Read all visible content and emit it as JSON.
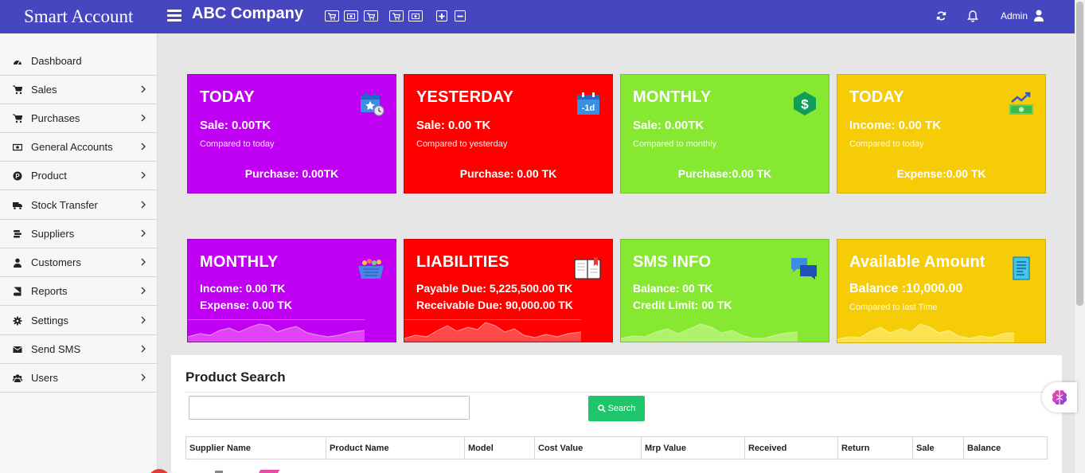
{
  "header": {
    "brand": "Smart Account",
    "company": "ABC Company",
    "quick_icons": [
      "cart-icon",
      "cash-icon",
      "cart-icon",
      "cart-icon",
      "cash-icon",
      "plus-icon",
      "minus-icon"
    ],
    "user": "Admin",
    "color": "#4646c1"
  },
  "sidebar": {
    "items": [
      {
        "label": "Dashboard",
        "icon": "dashboard-icon"
      },
      {
        "label": "Sales",
        "icon": "cart-icon"
      },
      {
        "label": "Purchases",
        "icon": "cart-icon"
      },
      {
        "label": "General Accounts",
        "icon": "cash-icon"
      },
      {
        "label": "Product",
        "icon": "product-icon"
      },
      {
        "label": "Stock Transfer",
        "icon": "truck-icon"
      },
      {
        "label": "Suppliers",
        "icon": "stack-icon"
      },
      {
        "label": "Customers",
        "icon": "user-icon"
      },
      {
        "label": "Reports",
        "icon": "book-icon"
      },
      {
        "label": "Settings",
        "icon": "gear-icon"
      },
      {
        "label": "Send SMS",
        "icon": "envelope-icon"
      },
      {
        "label": "Users",
        "icon": "users-icon"
      }
    ]
  },
  "cards": {
    "today_sale": {
      "title": "TODAY",
      "sale": "Sale: 0.00TK",
      "note": "Compared to today",
      "footer": "Purchase: 0.00TK"
    },
    "yesterday": {
      "title": "YESTERDAY",
      "sale": "Sale: 0.00 TK",
      "note": "Compared to yesterday",
      "footer": "Purchase: 0.00 TK"
    },
    "monthly_sale": {
      "title": "MONTHLY",
      "sale": "Sale: 0.00TK",
      "note": "Compared to monthly",
      "footer": "Purchase:0.00 TK"
    },
    "today_income": {
      "title": "TODAY",
      "sale": "Income: 0.00 TK",
      "note": "Compared to today",
      "footer": "Expense:0.00 TK"
    },
    "monthly_income": {
      "title": "MONTHLY",
      "line1": "Income: 0.00 TK",
      "line2": "Expense: 0.00 TK"
    },
    "liabilities": {
      "title": "LIABILITIES",
      "line1": "Payable Due: 5,225,500.00 TK",
      "line2": "Receivable Due: 90,000.00 TK"
    },
    "sms": {
      "title": "SMS INFO",
      "line1": "Balance: 00 TK",
      "line2": "Credit Limit: 00 TK"
    },
    "available": {
      "title": "Available Amount",
      "line1": "Balance :10,000.00",
      "note": "Compared to last Time"
    }
  },
  "colors": {
    "purple": "#bf00f2",
    "red": "#ff0000",
    "green": "#87e832",
    "yellow": "#f6cc06",
    "search_button": "#1ec66b"
  },
  "product_search": {
    "title": "Product Search",
    "input_value": "",
    "button": "Search",
    "columns": [
      "Supplier Name",
      "Product Name",
      "Model",
      "Cost Value",
      "Mrp Value",
      "Received",
      "Return",
      "Sale",
      "Balance"
    ]
  }
}
